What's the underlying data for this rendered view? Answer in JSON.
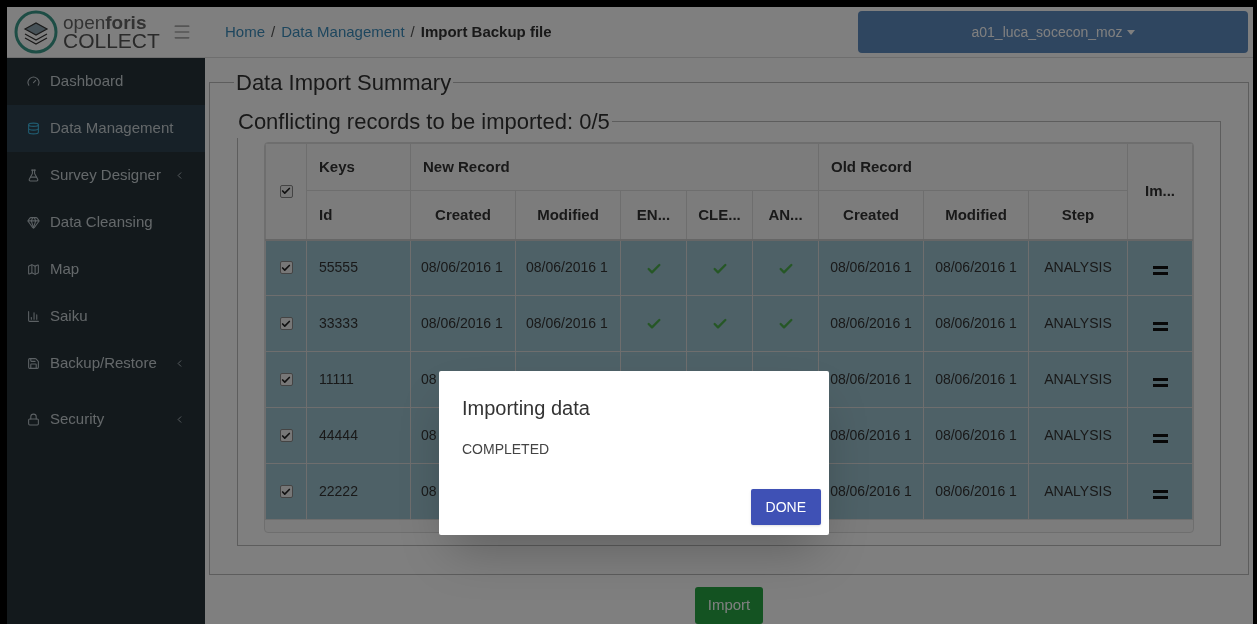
{
  "header": {
    "logo_top": "open**foris**",
    "logo_bottom": "COLLECT",
    "breadcrumb": [
      {
        "label": "Home",
        "current": false
      },
      {
        "label": "Data Management",
        "current": false
      },
      {
        "label": "Import Backup file",
        "current": true
      }
    ],
    "separator": "/",
    "user": "a01_luca_socecon_moz"
  },
  "sidebar": {
    "items": [
      {
        "label": "Dashboard",
        "selected": false,
        "submenu": false
      },
      {
        "label": "Data Management",
        "selected": true,
        "submenu": false
      },
      {
        "label": "Survey Designer",
        "selected": false,
        "submenu": true
      },
      {
        "label": "Data Cleansing",
        "selected": false,
        "submenu": false
      },
      {
        "label": "Map",
        "selected": false,
        "submenu": false
      },
      {
        "label": "Saiku",
        "selected": false,
        "submenu": false
      },
      {
        "label": "Backup/Restore",
        "selected": false,
        "submenu": true
      },
      {
        "label": "Security",
        "selected": false,
        "submenu": true
      }
    ]
  },
  "summary": {
    "title": "Data Import Summary",
    "conflicts_title": "Conflicting records to be imported: 0/5",
    "table": {
      "select_all_checked": true,
      "groups": [
        "Keys",
        "New Record",
        "Old Record",
        "Im..."
      ],
      "columns": [
        "Id",
        "Created",
        "Modified",
        "EN...",
        "CLE...",
        "AN...",
        "Created",
        "Modified",
        "Step"
      ],
      "rows": [
        {
          "checked": true,
          "selected": true,
          "id": "55555",
          "new_created": "08/06/2016 1",
          "new_modified": "08/06/2016 1",
          "steps": [
            true,
            true,
            true
          ],
          "old_created": "08/06/2016 1",
          "old_modified": "08/06/2016 1",
          "step": "ANALYSIS"
        },
        {
          "checked": true,
          "selected": true,
          "id": "33333",
          "new_created": "08/06/2016 1",
          "new_modified": "08/06/2016 1",
          "steps": [
            true,
            true,
            true
          ],
          "old_created": "08/06/2016 1",
          "old_modified": "08/06/2016 1",
          "step": "ANALYSIS"
        },
        {
          "checked": true,
          "selected": true,
          "id": "11111",
          "new_created": "08",
          "old_created": "08/06/2016 1",
          "old_modified": "08/06/2016 1",
          "step": "ANALYSIS"
        },
        {
          "checked": true,
          "selected": true,
          "id": "44444",
          "new_created": "08",
          "old_created": "08/06/2016 1",
          "old_modified": "08/06/2016 1",
          "step": "ANALYSIS"
        },
        {
          "checked": true,
          "selected": true,
          "id": "22222",
          "new_created": "08",
          "old_created": "08/06/2016 1",
          "old_modified": "08/06/2016 1",
          "step": "ANALYSIS"
        }
      ]
    },
    "import_button": "Import"
  },
  "dialog": {
    "title": "Importing data",
    "message": "COMPLETED",
    "button": "DONE"
  }
}
